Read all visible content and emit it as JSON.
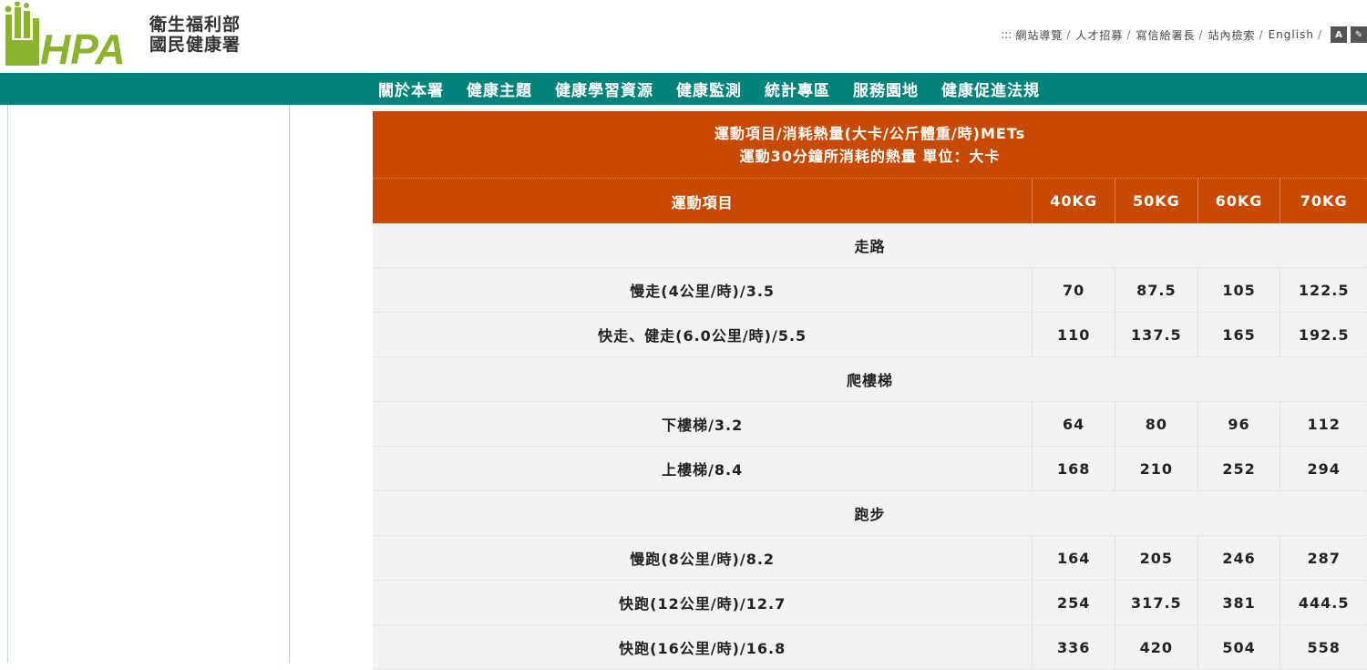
{
  "header": {
    "logo_text": "HPA",
    "org_name_line1": "衛生福利部",
    "org_name_line2": "國民健康署",
    "accessibility_key": ":::",
    "top_links": [
      "網站導覽",
      "人才招募",
      "寫信給署長",
      "站內檢索",
      "English"
    ],
    "font_size_btn": "A",
    "theme_btn": "✎"
  },
  "nav": {
    "items": [
      "關於本署",
      "健康主題",
      "健康學習資源",
      "健康監測",
      "統計專區",
      "服務園地",
      "健康促進法規"
    ]
  },
  "table": {
    "title_line1": "運動項目/消耗熱量(大卡/公斤體重/時)METs",
    "title_line2": "運動30分鐘所消耗的熱量 單位：大卡",
    "headers": [
      "運動項目",
      "40KG",
      "50KG",
      "60KG",
      "70KG"
    ],
    "groups": [
      {
        "name": "走路",
        "rows": [
          {
            "name": "慢走(4公里/時)/3.5",
            "values": [
              "70",
              "87.5",
              "105",
              "122.5"
            ]
          },
          {
            "name": "快走、健走(6.0公里/時)/5.5",
            "values": [
              "110",
              "137.5",
              "165",
              "192.5"
            ]
          }
        ]
      },
      {
        "name": "爬樓梯",
        "rows": [
          {
            "name": "下樓梯/3.2",
            "values": [
              "64",
              "80",
              "96",
              "112"
            ]
          },
          {
            "name": "上樓梯/8.4",
            "values": [
              "168",
              "210",
              "252",
              "294"
            ]
          }
        ]
      },
      {
        "name": "跑步",
        "rows": [
          {
            "name": "慢跑(8公里/時)/8.2",
            "values": [
              "164",
              "205",
              "246",
              "287"
            ]
          },
          {
            "name": "快跑(12公里/時)/12.7",
            "values": [
              "254",
              "317.5",
              "381",
              "444.5"
            ]
          },
          {
            "name": "快跑(16公里/時)/16.8",
            "values": [
              "336",
              "420",
              "504",
              "558"
            ]
          }
        ]
      }
    ]
  },
  "colors": {
    "brand_green": "#8cb32d",
    "nav_teal": "#00847a",
    "table_header": "#c84a00",
    "row_bg": "#f2f2f2"
  }
}
